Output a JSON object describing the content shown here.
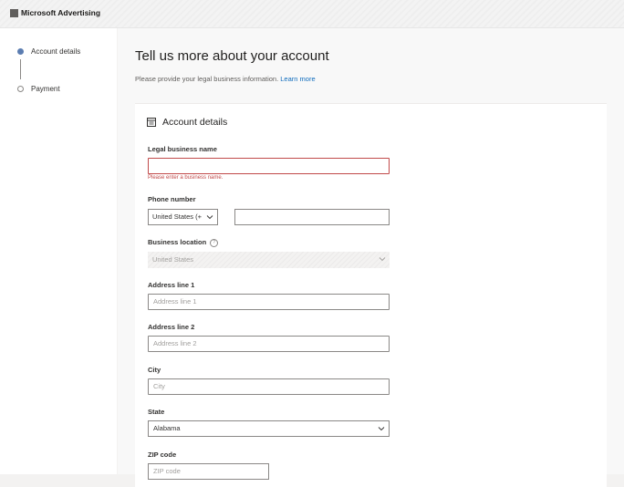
{
  "header": {
    "brand": "Microsoft Advertising",
    "logo_icon": "microsoft-logo-icon"
  },
  "steps": [
    {
      "label": "Account details",
      "state": "active"
    },
    {
      "label": "Payment",
      "state": "inactive"
    }
  ],
  "page": {
    "title": "Tell us more about your account",
    "subtitle": "Please provide your legal business information.",
    "learn_more": "Learn more"
  },
  "card": {
    "title": "Account details",
    "icon": "form-icon",
    "fields": {
      "legal_name": {
        "label": "Legal business name",
        "value": "",
        "error": "Please enter a business name."
      },
      "phone": {
        "label": "Phone number",
        "country": "United States (+",
        "number": ""
      },
      "location": {
        "label": "Business location",
        "value": "United States"
      },
      "address1": {
        "label": "Address line 1",
        "placeholder": "Address line 1"
      },
      "address2": {
        "label": "Address line 2",
        "placeholder": "Address line 2"
      },
      "city": {
        "label": "City",
        "placeholder": "City"
      },
      "state": {
        "label": "State",
        "value": "Alabama"
      },
      "zip": {
        "label": "ZIP code",
        "placeholder": "ZIP code"
      }
    }
  },
  "colors": {
    "accent": "#5b7db1",
    "error": "#c14a4a",
    "link": "#0f6cbd"
  }
}
